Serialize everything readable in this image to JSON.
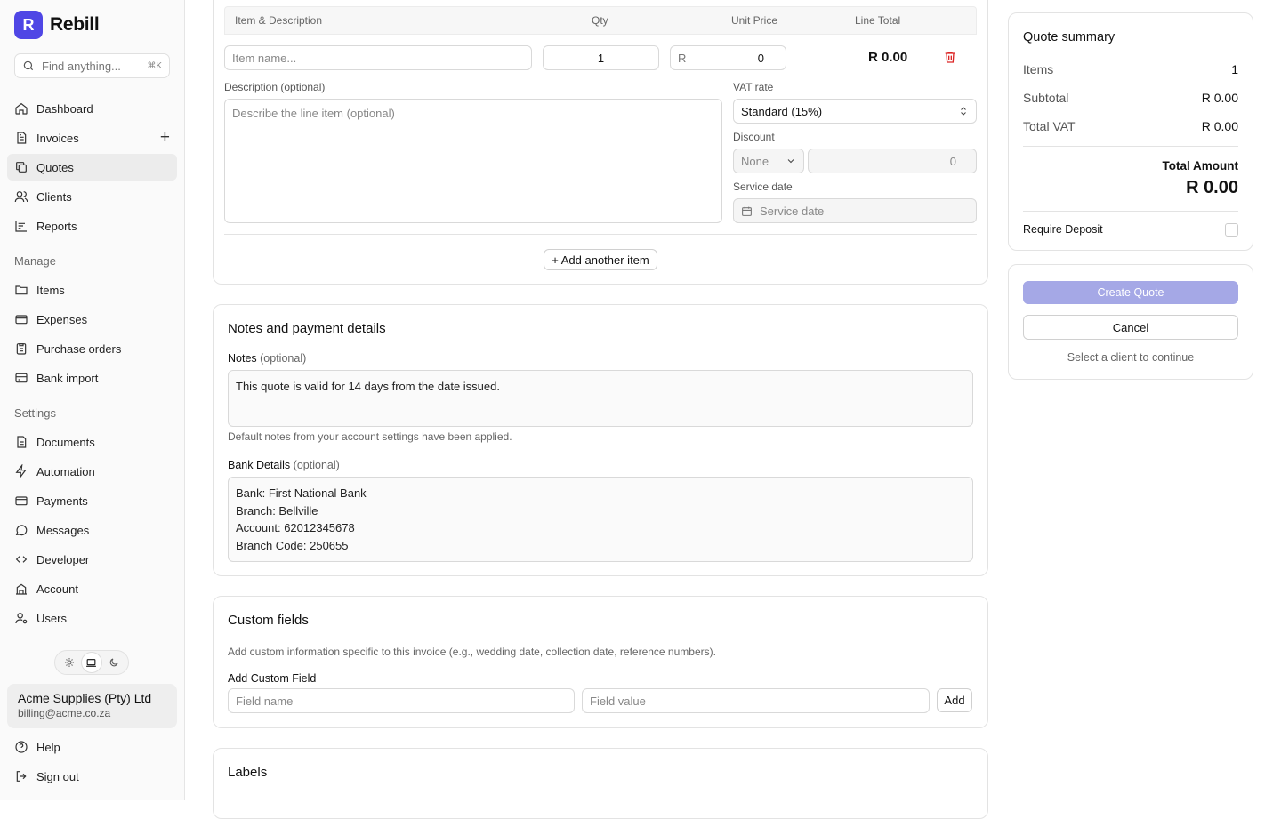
{
  "app": {
    "logo_letter": "R",
    "name": "Rebill",
    "brand_color": "#4f46e5"
  },
  "search": {
    "placeholder": "Find anything...",
    "shortcut": "⌘K"
  },
  "nav_main": [
    {
      "label": "Dashboard",
      "icon": "home-icon"
    },
    {
      "label": "Invoices",
      "icon": "file-icon",
      "action": "+"
    },
    {
      "label": "Quotes",
      "icon": "copy-icon",
      "active": true
    },
    {
      "label": "Clients",
      "icon": "users-icon"
    },
    {
      "label": "Reports",
      "icon": "chart-icon"
    }
  ],
  "section_manage": "Manage",
  "nav_manage": [
    {
      "label": "Items",
      "icon": "folder-icon"
    },
    {
      "label": "Expenses",
      "icon": "card-icon"
    },
    {
      "label": "Purchase orders",
      "icon": "clipboard-icon"
    },
    {
      "label": "Bank import",
      "icon": "bank-icon"
    }
  ],
  "section_settings": "Settings",
  "nav_settings": [
    {
      "label": "Documents",
      "icon": "document-icon"
    },
    {
      "label": "Automation",
      "icon": "bolt-icon"
    },
    {
      "label": "Payments",
      "icon": "card-icon"
    },
    {
      "label": "Messages",
      "icon": "message-icon"
    },
    {
      "label": "Developer",
      "icon": "code-icon"
    },
    {
      "label": "Account",
      "icon": "building-icon"
    },
    {
      "label": "Users",
      "icon": "user-cog-icon"
    }
  ],
  "account": {
    "name": "Acme Supplies (Pty) Ltd",
    "email": "billing@acme.co.za"
  },
  "footer_nav": {
    "help": "Help",
    "sign_out": "Sign out"
  },
  "items_table": {
    "headers": {
      "item": "Item & Description",
      "qty": "Qty",
      "unit_price": "Unit Price",
      "line_total": "Line Total"
    },
    "item_placeholder": "Item name...",
    "qty": "1",
    "currency": "R",
    "unit_price": "0",
    "line_total": "R 0.00",
    "description_label": "Description (optional)",
    "description_placeholder": "Describe the line item (optional)",
    "vat_label": "VAT rate",
    "vat_value": "Standard (15%)",
    "discount_label": "Discount",
    "discount_type": "None",
    "discount_value": "0",
    "service_date_label": "Service date",
    "service_date_placeholder": "Service date",
    "add_item": "+ Add another item"
  },
  "notes_card": {
    "title": "Notes and payment details",
    "notes_label": "Notes",
    "optional": "(optional)",
    "notes_value": "This quote is valid for 14 days from the date issued.",
    "notes_hint": "Default notes from your account settings have been applied.",
    "bank_label": "Bank Details",
    "bank_lines": [
      "Bank: First National Bank",
      "Branch: Bellville",
      "Account: 62012345678",
      "Branch Code: 250655"
    ]
  },
  "custom_fields": {
    "title": "Custom fields",
    "description": "Add custom information specific to this invoice (e.g., wedding date, collection date, reference numbers).",
    "add_label": "Add Custom Field",
    "name_placeholder": "Field name",
    "value_placeholder": "Field value",
    "add_button": "Add"
  },
  "labels_card": {
    "title": "Labels"
  },
  "summary": {
    "title": "Quote summary",
    "items_label": "Items",
    "items_value": "1",
    "subtotal_label": "Subtotal",
    "subtotal_value": "R 0.00",
    "vat_label": "Total VAT",
    "vat_value": "R 0.00",
    "total_label": "Total Amount",
    "total_value": "R 0.00",
    "deposit_label": "Require Deposit"
  },
  "actions": {
    "create": "Create Quote",
    "cancel": "Cancel",
    "hint": "Select a client to continue"
  },
  "colors": {
    "accent": "#4f46e5",
    "create_disabled": "#a5a8e6",
    "danger": "#dc2626"
  }
}
